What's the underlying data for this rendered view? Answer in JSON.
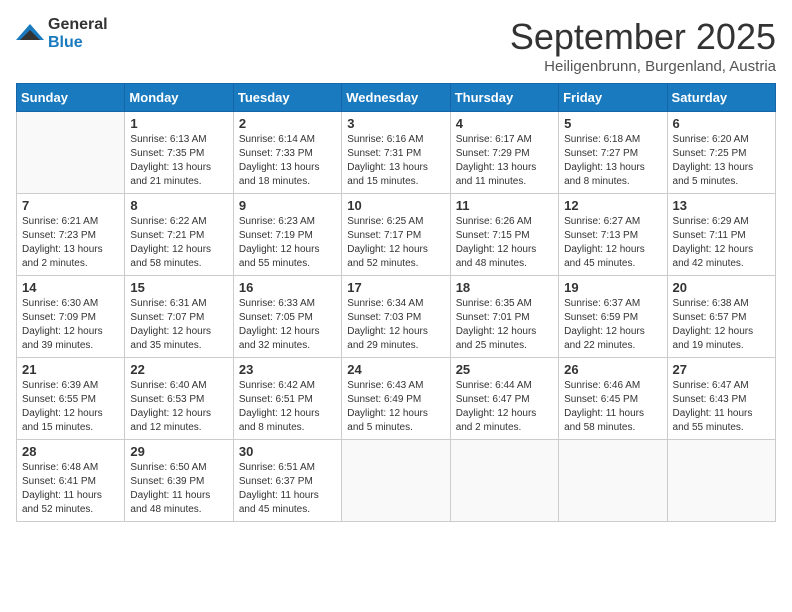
{
  "logo": {
    "general": "General",
    "blue": "Blue"
  },
  "header": {
    "month": "September 2025",
    "location": "Heiligenbrunn, Burgenland, Austria"
  },
  "days_of_week": [
    "Sunday",
    "Monday",
    "Tuesday",
    "Wednesday",
    "Thursday",
    "Friday",
    "Saturday"
  ],
  "weeks": [
    [
      {
        "day": "",
        "sunrise": "",
        "sunset": "",
        "daylight": ""
      },
      {
        "day": "1",
        "sunrise": "Sunrise: 6:13 AM",
        "sunset": "Sunset: 7:35 PM",
        "daylight": "Daylight: 13 hours and 21 minutes."
      },
      {
        "day": "2",
        "sunrise": "Sunrise: 6:14 AM",
        "sunset": "Sunset: 7:33 PM",
        "daylight": "Daylight: 13 hours and 18 minutes."
      },
      {
        "day": "3",
        "sunrise": "Sunrise: 6:16 AM",
        "sunset": "Sunset: 7:31 PM",
        "daylight": "Daylight: 13 hours and 15 minutes."
      },
      {
        "day": "4",
        "sunrise": "Sunrise: 6:17 AM",
        "sunset": "Sunset: 7:29 PM",
        "daylight": "Daylight: 13 hours and 11 minutes."
      },
      {
        "day": "5",
        "sunrise": "Sunrise: 6:18 AM",
        "sunset": "Sunset: 7:27 PM",
        "daylight": "Daylight: 13 hours and 8 minutes."
      },
      {
        "day": "6",
        "sunrise": "Sunrise: 6:20 AM",
        "sunset": "Sunset: 7:25 PM",
        "daylight": "Daylight: 13 hours and 5 minutes."
      }
    ],
    [
      {
        "day": "7",
        "sunrise": "Sunrise: 6:21 AM",
        "sunset": "Sunset: 7:23 PM",
        "daylight": "Daylight: 13 hours and 2 minutes."
      },
      {
        "day": "8",
        "sunrise": "Sunrise: 6:22 AM",
        "sunset": "Sunset: 7:21 PM",
        "daylight": "Daylight: 12 hours and 58 minutes."
      },
      {
        "day": "9",
        "sunrise": "Sunrise: 6:23 AM",
        "sunset": "Sunset: 7:19 PM",
        "daylight": "Daylight: 12 hours and 55 minutes."
      },
      {
        "day": "10",
        "sunrise": "Sunrise: 6:25 AM",
        "sunset": "Sunset: 7:17 PM",
        "daylight": "Daylight: 12 hours and 52 minutes."
      },
      {
        "day": "11",
        "sunrise": "Sunrise: 6:26 AM",
        "sunset": "Sunset: 7:15 PM",
        "daylight": "Daylight: 12 hours and 48 minutes."
      },
      {
        "day": "12",
        "sunrise": "Sunrise: 6:27 AM",
        "sunset": "Sunset: 7:13 PM",
        "daylight": "Daylight: 12 hours and 45 minutes."
      },
      {
        "day": "13",
        "sunrise": "Sunrise: 6:29 AM",
        "sunset": "Sunset: 7:11 PM",
        "daylight": "Daylight: 12 hours and 42 minutes."
      }
    ],
    [
      {
        "day": "14",
        "sunrise": "Sunrise: 6:30 AM",
        "sunset": "Sunset: 7:09 PM",
        "daylight": "Daylight: 12 hours and 39 minutes."
      },
      {
        "day": "15",
        "sunrise": "Sunrise: 6:31 AM",
        "sunset": "Sunset: 7:07 PM",
        "daylight": "Daylight: 12 hours and 35 minutes."
      },
      {
        "day": "16",
        "sunrise": "Sunrise: 6:33 AM",
        "sunset": "Sunset: 7:05 PM",
        "daylight": "Daylight: 12 hours and 32 minutes."
      },
      {
        "day": "17",
        "sunrise": "Sunrise: 6:34 AM",
        "sunset": "Sunset: 7:03 PM",
        "daylight": "Daylight: 12 hours and 29 minutes."
      },
      {
        "day": "18",
        "sunrise": "Sunrise: 6:35 AM",
        "sunset": "Sunset: 7:01 PM",
        "daylight": "Daylight: 12 hours and 25 minutes."
      },
      {
        "day": "19",
        "sunrise": "Sunrise: 6:37 AM",
        "sunset": "Sunset: 6:59 PM",
        "daylight": "Daylight: 12 hours and 22 minutes."
      },
      {
        "day": "20",
        "sunrise": "Sunrise: 6:38 AM",
        "sunset": "Sunset: 6:57 PM",
        "daylight": "Daylight: 12 hours and 19 minutes."
      }
    ],
    [
      {
        "day": "21",
        "sunrise": "Sunrise: 6:39 AM",
        "sunset": "Sunset: 6:55 PM",
        "daylight": "Daylight: 12 hours and 15 minutes."
      },
      {
        "day": "22",
        "sunrise": "Sunrise: 6:40 AM",
        "sunset": "Sunset: 6:53 PM",
        "daylight": "Daylight: 12 hours and 12 minutes."
      },
      {
        "day": "23",
        "sunrise": "Sunrise: 6:42 AM",
        "sunset": "Sunset: 6:51 PM",
        "daylight": "Daylight: 12 hours and 8 minutes."
      },
      {
        "day": "24",
        "sunrise": "Sunrise: 6:43 AM",
        "sunset": "Sunset: 6:49 PM",
        "daylight": "Daylight: 12 hours and 5 minutes."
      },
      {
        "day": "25",
        "sunrise": "Sunrise: 6:44 AM",
        "sunset": "Sunset: 6:47 PM",
        "daylight": "Daylight: 12 hours and 2 minutes."
      },
      {
        "day": "26",
        "sunrise": "Sunrise: 6:46 AM",
        "sunset": "Sunset: 6:45 PM",
        "daylight": "Daylight: 11 hours and 58 minutes."
      },
      {
        "day": "27",
        "sunrise": "Sunrise: 6:47 AM",
        "sunset": "Sunset: 6:43 PM",
        "daylight": "Daylight: 11 hours and 55 minutes."
      }
    ],
    [
      {
        "day": "28",
        "sunrise": "Sunrise: 6:48 AM",
        "sunset": "Sunset: 6:41 PM",
        "daylight": "Daylight: 11 hours and 52 minutes."
      },
      {
        "day": "29",
        "sunrise": "Sunrise: 6:50 AM",
        "sunset": "Sunset: 6:39 PM",
        "daylight": "Daylight: 11 hours and 48 minutes."
      },
      {
        "day": "30",
        "sunrise": "Sunrise: 6:51 AM",
        "sunset": "Sunset: 6:37 PM",
        "daylight": "Daylight: 11 hours and 45 minutes."
      },
      {
        "day": "",
        "sunrise": "",
        "sunset": "",
        "daylight": ""
      },
      {
        "day": "",
        "sunrise": "",
        "sunset": "",
        "daylight": ""
      },
      {
        "day": "",
        "sunrise": "",
        "sunset": "",
        "daylight": ""
      },
      {
        "day": "",
        "sunrise": "",
        "sunset": "",
        "daylight": ""
      }
    ]
  ]
}
